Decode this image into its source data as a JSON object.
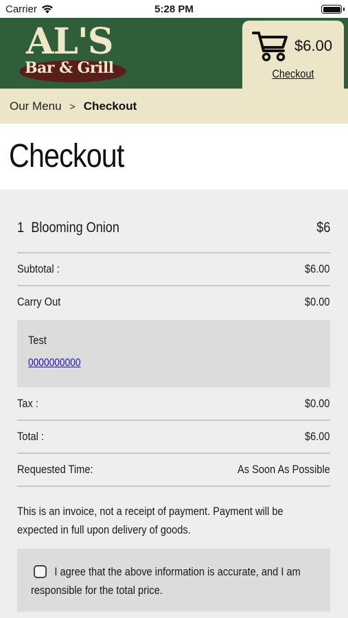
{
  "status_bar": {
    "carrier": "Carrier",
    "time": "5:28 PM",
    "icons": [
      "wifi-icon",
      "battery-icon"
    ]
  },
  "header": {
    "logo_title": "AL'S",
    "logo_subtitle": "Bar & Grill",
    "cart_total": "$6.00",
    "checkout_link": "Checkout",
    "colors": {
      "header_bg": "#2e5e3a",
      "tab_bg": "#ede5c8",
      "logo_oval": "#5a1e1a"
    }
  },
  "breadcrumb": {
    "home": "Our Menu",
    "separator": ">",
    "current": "Checkout"
  },
  "page": {
    "title": "Checkout"
  },
  "order": {
    "items": [
      {
        "qty": "1",
        "name": "Blooming Onion",
        "price": "$6"
      }
    ],
    "subtotal_label": "Subtotal :",
    "subtotal_value": "$6.00",
    "carry_out_label": "Carry Out",
    "carry_out_value": "$0.00",
    "customer": {
      "name": "Test",
      "phone": "0000000000"
    },
    "tax_label": "Tax :",
    "tax_value": "$0.00",
    "total_label": "Total :",
    "total_value": "$6.00",
    "requested_time_label": "Requested Time:",
    "requested_time_value": "As Soon As Possible",
    "invoice_note": "This is an invoice, not a receipt of payment. Payment will be expected in full upon delivery of goods.",
    "agreement": {
      "checked": false,
      "text": "I agree that the above information is accurate, and I am responsible for the total price."
    }
  }
}
